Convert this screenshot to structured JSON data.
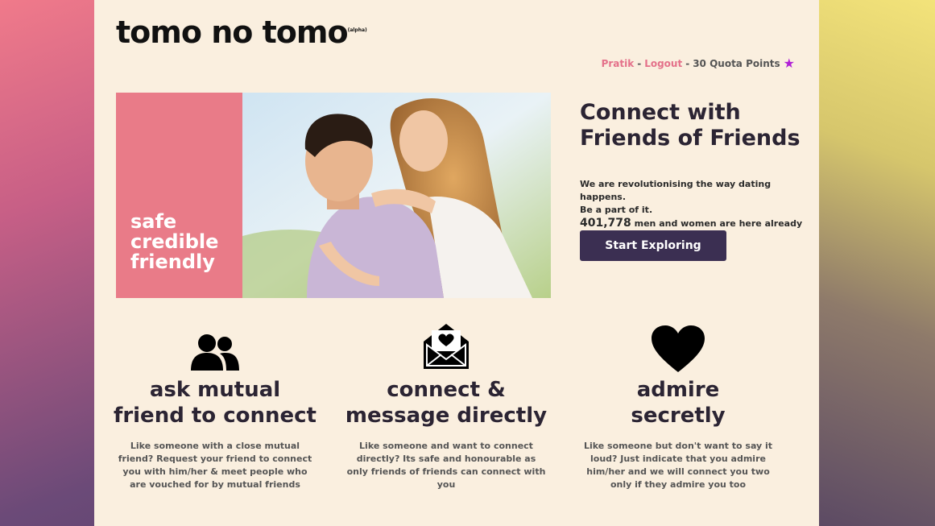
{
  "brand": {
    "name": "tomo no tomo",
    "tag": "(alpha)"
  },
  "userbar": {
    "user": "Pratik",
    "sep1": "-",
    "logout": "Logout",
    "sep2": "-",
    "points": "30 Quota Points",
    "star_icon": "star-icon",
    "star_color": "#b01fd6"
  },
  "hero": {
    "words": [
      "safe",
      "credible",
      "friendly"
    ],
    "pink_color": "#e97b88"
  },
  "side": {
    "title_line1": "Connect with",
    "title_line2": "Friends of Friends",
    "sub_line1": "We are revolutionising the way dating happens.",
    "sub_line2": "Be a part of it.",
    "count": "401,778",
    "count_suffix": "men and women are here already",
    "cta": "Start Exploring",
    "cta_color": "#3b2f52"
  },
  "features": [
    {
      "icon": "users-icon",
      "title_line1": "ask mutual",
      "title_line2": "friend to connect",
      "desc": "Like someone with a close mutual friend? Request your friend to connect you with him/her & meet people who are vouched for by mutual friends"
    },
    {
      "icon": "envelope-heart-icon",
      "title_line1": "connect &",
      "title_line2": "message directly",
      "desc": "Like someone and want to connect directly? Its safe and honourable as only friends of friends can connect with you"
    },
    {
      "icon": "heart-icon",
      "title_line1": "admire",
      "title_line2": "secretly",
      "desc": "Like someone but don't want to say it loud? Just indicate that you admire him/her and we will connect you two only if they admire you too"
    }
  ]
}
